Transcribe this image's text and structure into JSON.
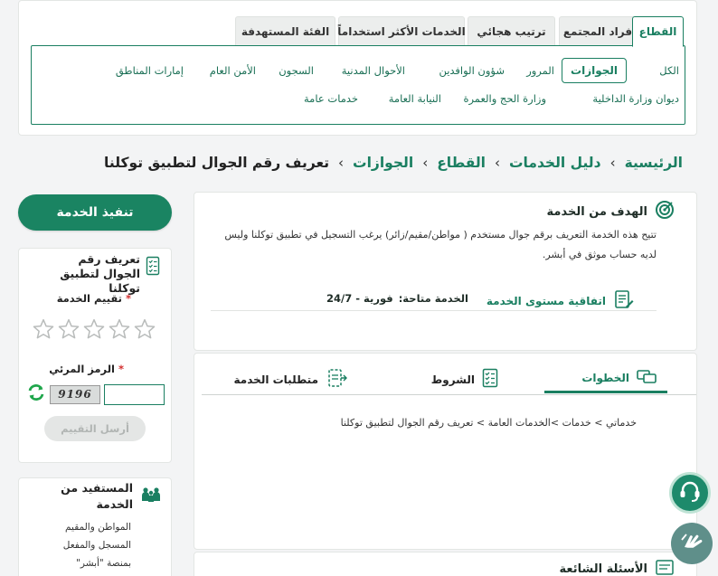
{
  "sector_filter": {
    "tabs": [
      {
        "label": "القطاع",
        "active": true
      },
      {
        "label": "أفراد المجتمع",
        "active": false
      },
      {
        "label": "ترتيب هجائي",
        "active": false
      },
      {
        "label": "الخدمات الأكثر استخداماً",
        "active": false
      },
      {
        "label": "الفئة المستهدفة",
        "active": false
      }
    ],
    "row1": [
      "الكل",
      "الجوازات",
      "المرور",
      "شؤون الوافدين",
      "الأحوال المدنية",
      "السجون",
      "الأمن العام",
      "إمارات المناطق"
    ],
    "row2": [
      "ديوان وزارة الداخلية",
      "وزارة الحج والعمرة",
      "النيابة العامة",
      "خدمات عامة"
    ],
    "active_item": "الجوازات"
  },
  "breadcrumb": {
    "home": "الرئيسية",
    "guide": "دليل الخدمات",
    "sector": "القطاع",
    "passports": "الجوازات",
    "current": "تعريف رقم الجوال لتطبيق توكلنا",
    "separator": "›"
  },
  "goal": {
    "title": "الهدف من الخدمة",
    "description": "تتيح هذه الخدمة التعريف برقم جوال مستخدم ( مواطن/مقيم/زائر) يرغب التسجيل في تطبيق توكلنا وليس لديه حساب موثق في أبشر.",
    "sla_label": "اتفاقية مستوى الخدمة",
    "availability_label": "الخدمة متاحة:",
    "availability_value": "فورية - 24/7"
  },
  "details_tabs": {
    "steps_label": "الخطوات",
    "conditions_label": "الشروط",
    "requirements_label": "متطلبات الخدمة",
    "steps_path": "خدماتي > خدمات >الخدمات العامة > تعريف رقم الجوال لتطبيق توكلنا"
  },
  "faq": {
    "title": "الأسئلة الشائعة"
  },
  "sidebar": {
    "execute_label": "تنفيذ الخدمة",
    "service_name": "تعريف رقم الجوال لتطبيق توكلنا",
    "rating_label": "تقييم الخدمة",
    "required_mark": "*",
    "stars_total": 5,
    "rating_value": 0,
    "captcha_label": "الرمز المرئي",
    "captcha_text": "9196",
    "captcha_value": "",
    "send_label": "أرسل التقييم",
    "beneficiary_title": "المستفيد من الخدمة",
    "beneficiary_text": "المواطن والمقيم المسجل والمفعل بمنصة \"أبشر\""
  },
  "colors": {
    "accent": "#1a7f61",
    "accent_button": "#1a8462",
    "required": "#d32f2f",
    "page_bg": "#f3f4f5"
  }
}
